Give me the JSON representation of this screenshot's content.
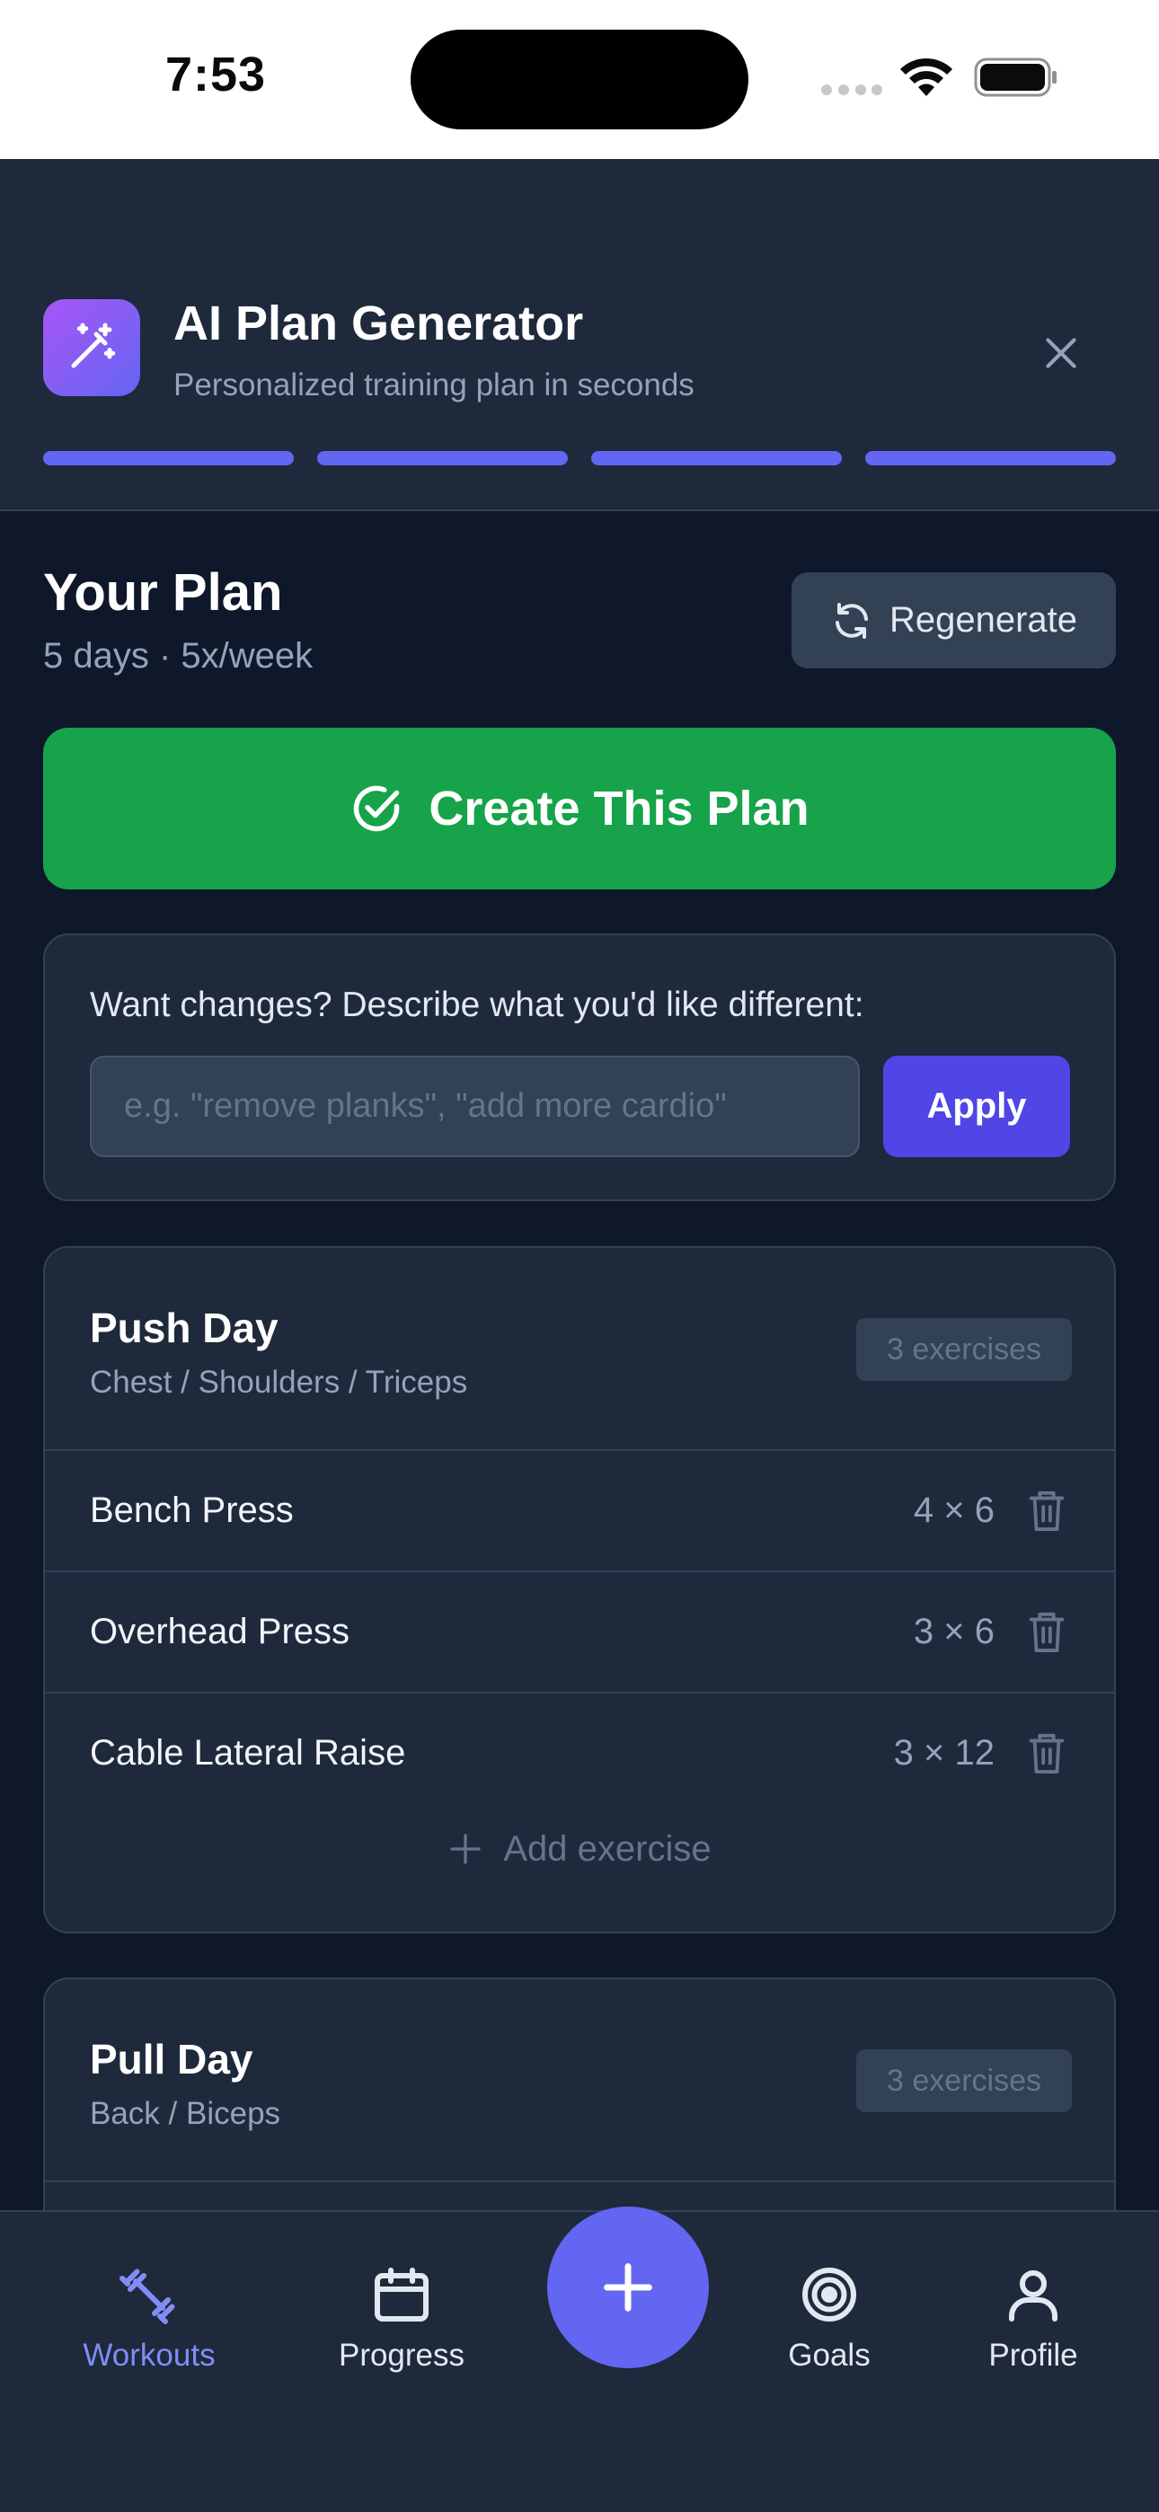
{
  "status_bar": {
    "time": "7:53"
  },
  "header": {
    "title": "AI Plan Generator",
    "subtitle": "Personalized training plan in seconds",
    "steps_completed": 4,
    "steps_total": 4
  },
  "plan": {
    "title": "Your Plan",
    "meta": "5 days · 5x/week",
    "regenerate_label": "Regenerate",
    "create_label": "Create This Plan"
  },
  "changes": {
    "label": "Want changes? Describe what you'd like different:",
    "placeholder": "e.g. \"remove planks\", \"add more cardio\"",
    "value": "",
    "apply_label": "Apply"
  },
  "days": [
    {
      "name": "Push Day",
      "muscles": "Chest / Shoulders / Triceps",
      "count_label": "3 exercises",
      "exercises": [
        {
          "name": "Bench Press",
          "sets": "4 × 6"
        },
        {
          "name": "Overhead Press",
          "sets": "3 × 6"
        },
        {
          "name": "Cable Lateral Raise",
          "sets": "3 × 12"
        }
      ],
      "add_label": "Add exercise"
    },
    {
      "name": "Pull Day",
      "muscles": "Back / Biceps",
      "count_label": "3 exercises"
    }
  ],
  "tabs": [
    {
      "label": "Workouts",
      "icon": "dumbbell-icon",
      "active": true
    },
    {
      "label": "Progress",
      "icon": "calendar-icon",
      "active": false
    },
    {
      "label": "Goals",
      "icon": "target-icon",
      "active": false
    },
    {
      "label": "Profile",
      "icon": "user-icon",
      "active": false
    }
  ],
  "colors": {
    "accent": "#6366f1",
    "create": "#16a34a",
    "background": "#0f172a",
    "surface": "#1e293b"
  }
}
